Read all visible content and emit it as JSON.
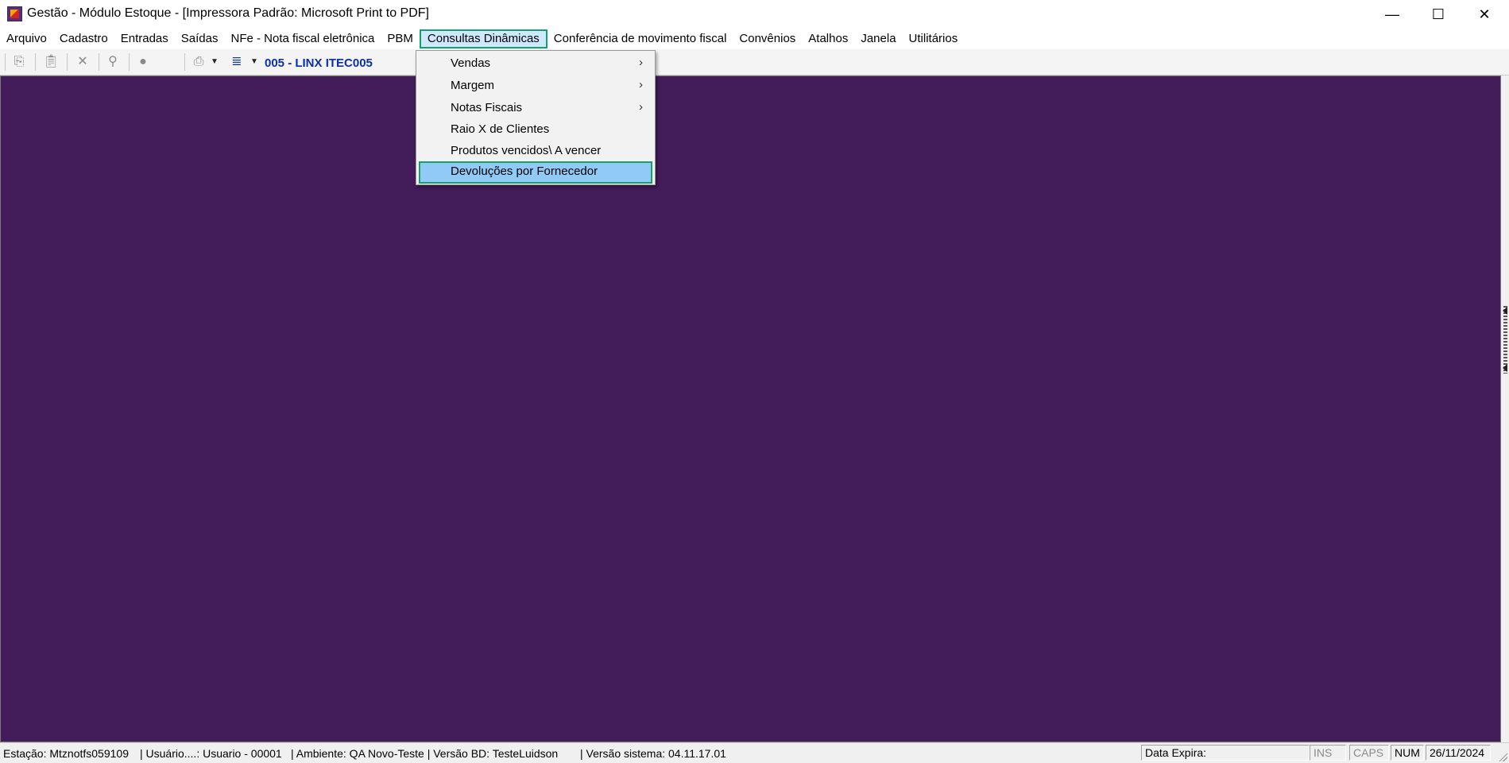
{
  "window": {
    "title": "Gestão  - Módulo Estoque - [Impressora Padrão: Microsoft Print to PDF]",
    "minimize": "—",
    "maximize": "☐",
    "close": "✕"
  },
  "menubar": {
    "items": [
      "Arquivo",
      "Cadastro",
      "Entradas",
      "Saídas",
      "NFe - Nota fiscal eletrônica",
      "PBM",
      "Consultas Dinâmicas",
      "Conferência de movimento fiscal",
      "Convênios",
      "Atalhos",
      "Janela",
      "Utilitários"
    ],
    "active_index": 6
  },
  "toolbar": {
    "company": "005 - LINX ITEC005",
    "icons": [
      "copy-icon",
      "paste-icon",
      "delete-icon",
      "search-icon",
      "record-icon",
      "print-icon",
      "dropdown-arrow-icon",
      "list-icon",
      "dropdown-arrow-icon"
    ]
  },
  "dropdown": {
    "items": [
      {
        "label": "Vendas",
        "submenu": true
      },
      {
        "label": "Margem",
        "submenu": true
      },
      {
        "label": "Notas Fiscais",
        "submenu": true
      },
      {
        "label": "Raio X de Clientes",
        "submenu": false
      },
      {
        "label": "Produtos vencidos\\ A vencer",
        "submenu": false
      },
      {
        "label": "Devoluções por Fornecedor",
        "submenu": false
      }
    ],
    "selected_index": 5
  },
  "statusbar": {
    "estacao": "Estação: Mtznotfs059109",
    "usuario": "| Usuário....: Usuario - 00001",
    "ambiente": "| Ambiente: QA Novo-Teste | Versão BD: TesteLuidson",
    "versao": "| Versão sistema: 04.11.17.01",
    "data_expira": "Data Expira:",
    "ins": "INS",
    "caps": "CAPS",
    "num": "NUM",
    "date": "26/11/2024"
  },
  "colors": {
    "workspace": "#431c5a",
    "highlight_border": "#16a06a",
    "selected_bg": "#91c9f7",
    "company_text": "#0b2fb0"
  }
}
